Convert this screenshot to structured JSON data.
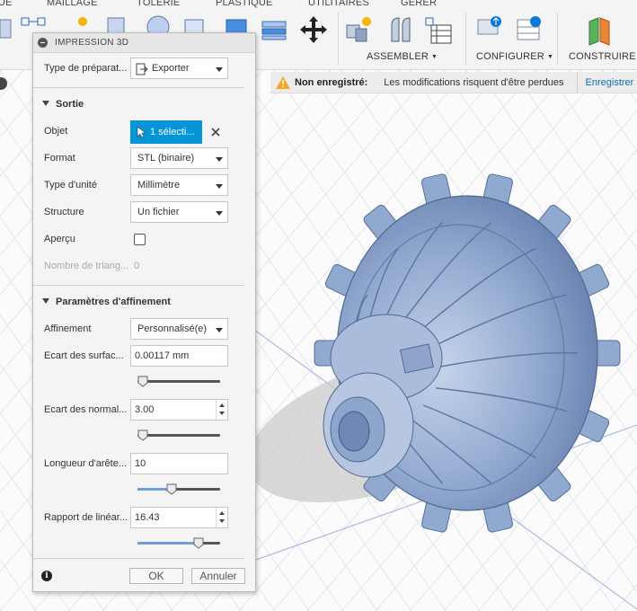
{
  "toolbar": {
    "tabs": [
      "UE",
      "MAILLAGE",
      "TÔLERIE",
      "PLASTIQUE",
      "UTILITAIRES",
      "GÉRER"
    ],
    "groups": {
      "assembler": "ASSEMBLER",
      "configurer": "CONFIGURER",
      "construire": "CONSTRUIRE"
    }
  },
  "notification": {
    "title": "Non enregistré:",
    "message": "Les modifications risquent d'être perdues",
    "save_link": "Enregistrer"
  },
  "dialog": {
    "title": "IMPRESSION 3D",
    "type_label": "Type de préparat...",
    "type_value": "Exporter",
    "sections": {
      "sortie": "Sortie",
      "parametres": "Paramètres d'affinement"
    },
    "objet": {
      "label": "Objet",
      "button": "1 sélecti..."
    },
    "format": {
      "label": "Format",
      "value": "STL (binaire)"
    },
    "unite": {
      "label": "Type d'unité",
      "value": "Millimètre"
    },
    "structure": {
      "label": "Structure",
      "value": "Un fichier"
    },
    "apercu": {
      "label": "Aperçu",
      "checked": false
    },
    "triangles": {
      "label": "Nombre de triang...",
      "value": "0"
    },
    "affinement": {
      "label": "Affinement",
      "value": "Personnalisé(e)"
    },
    "ecart_surface": {
      "label": "Ecart des surfac...",
      "value": "0.00117 mm",
      "slider": 0.0
    },
    "ecart_normale": {
      "label": "Ecart des normal...",
      "value": "3.00",
      "slider": 0.0
    },
    "longueur_arete": {
      "label": "Longueur d'arête...",
      "value": "10",
      "slider": 0.4
    },
    "rapport_lineaire": {
      "label": "Rapport de linéar...",
      "value": "16.43",
      "slider": 0.77
    },
    "ok": "OK",
    "cancel": "Annuler"
  },
  "colors": {
    "accent": "#0696d7",
    "slider_fill": "#6f9fd8",
    "model": "#8fa9cf",
    "warning": "#f5a623",
    "link": "#0b6fb6"
  }
}
